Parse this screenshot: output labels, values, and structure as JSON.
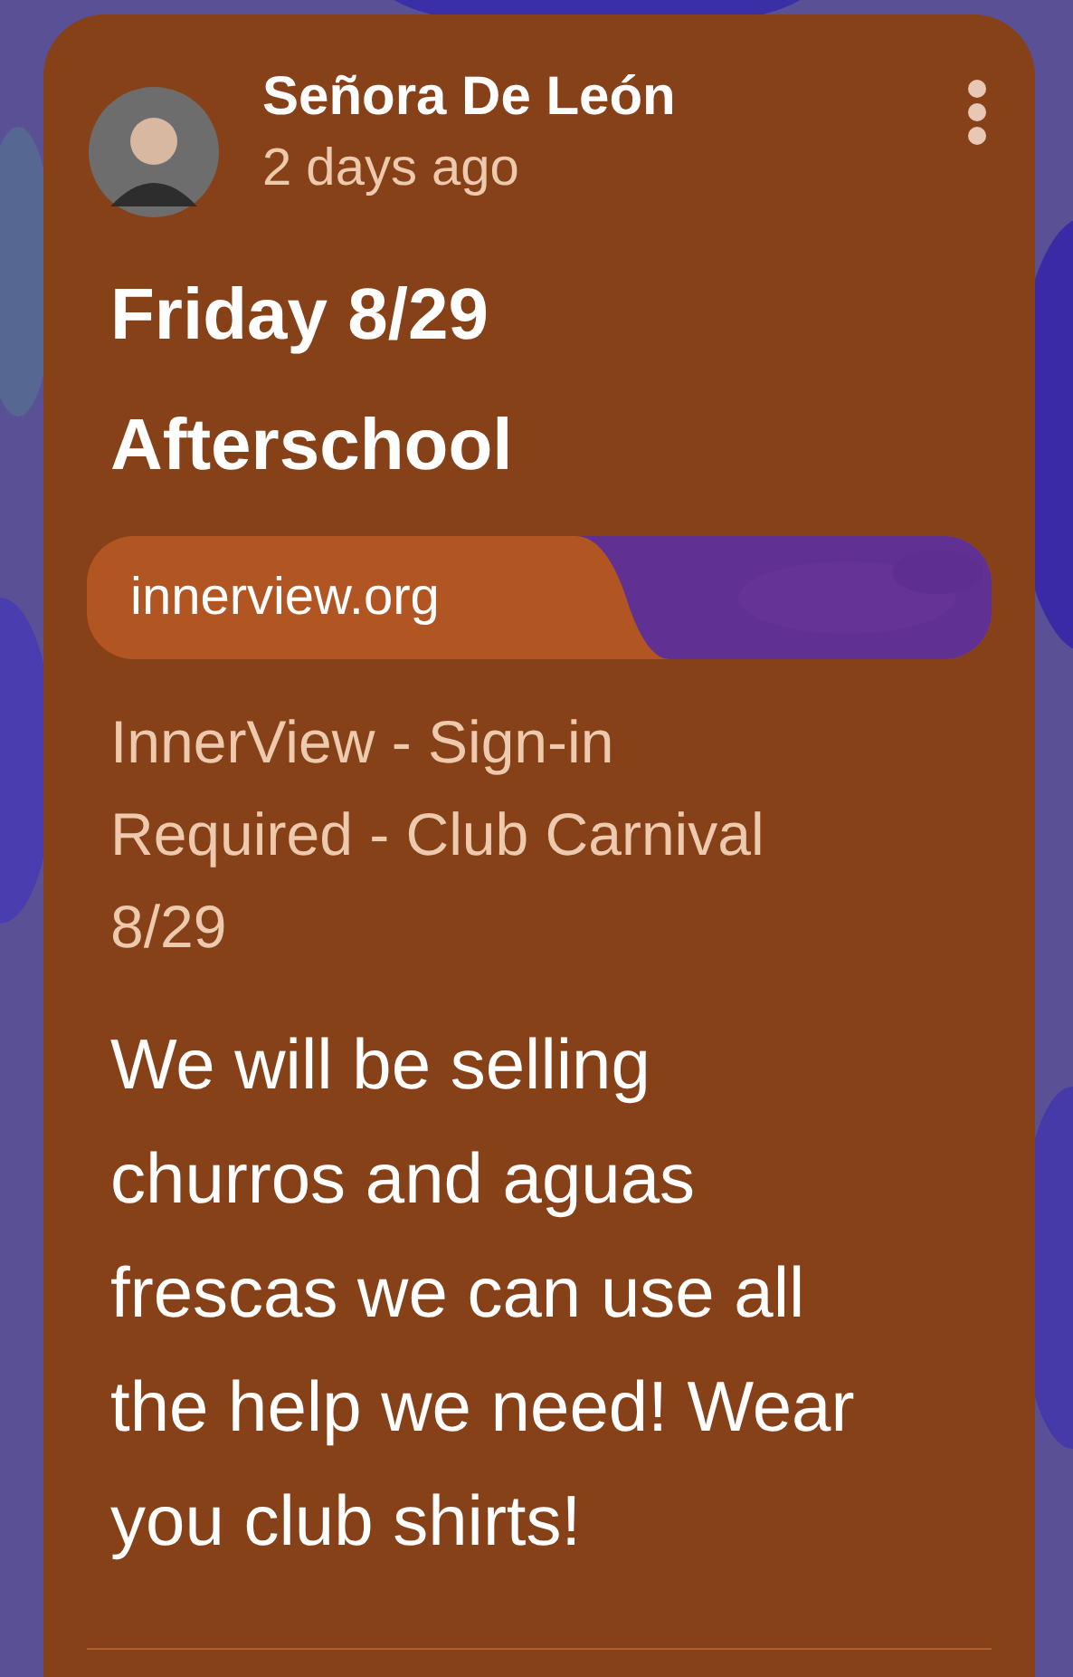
{
  "post": {
    "author": "Señora De León",
    "time": "2 days ago",
    "title": "Friday 8/29 Afterschool",
    "link": {
      "domain": "innerview.org",
      "description": "InnerView - Sign-in Required - Club Carnival 8/29"
    },
    "body": "We will be selling churros and aguas frescas we can use all the help we need! Wear you club shirts!"
  }
}
